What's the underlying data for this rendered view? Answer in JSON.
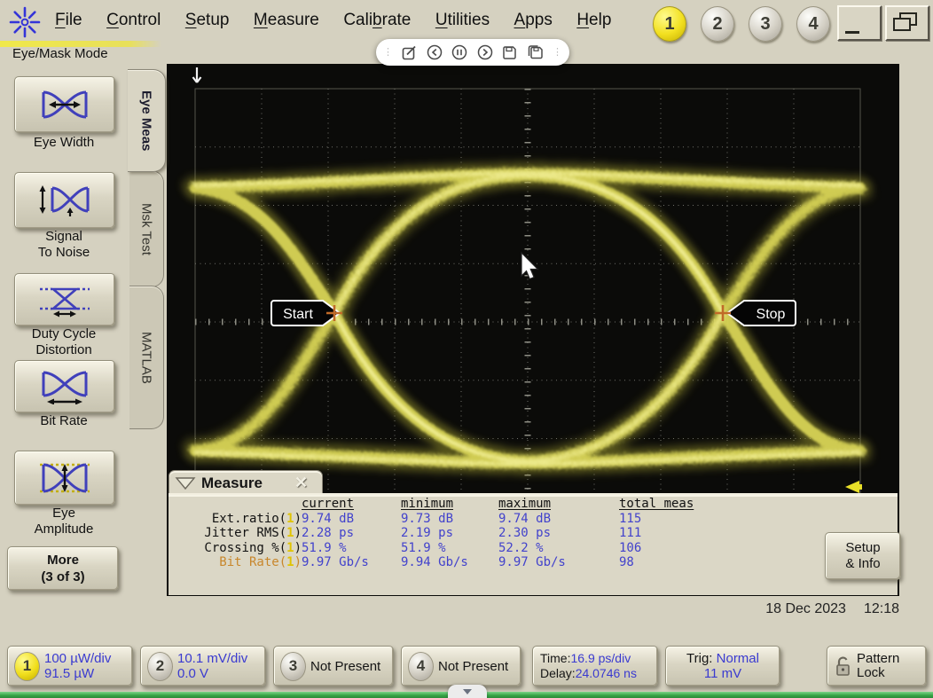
{
  "app": {
    "mode_label": "Eye/Mask Mode",
    "date": "18 Dec 2023",
    "time": "12:18"
  },
  "menu": {
    "items": [
      {
        "pre": "",
        "u": "F",
        "post": "ile"
      },
      {
        "pre": "",
        "u": "C",
        "post": "ontrol"
      },
      {
        "pre": "",
        "u": "S",
        "post": "etup"
      },
      {
        "pre": "",
        "u": "M",
        "post": "easure"
      },
      {
        "pre": "Cali",
        "u": "b",
        "post": "rate"
      },
      {
        "pre": "",
        "u": "U",
        "post": "tilities"
      },
      {
        "pre": "",
        "u": "A",
        "post": "pps"
      },
      {
        "pre": "",
        "u": "H",
        "post": "elp"
      }
    ],
    "screen_keys": [
      "1",
      "2",
      "3",
      "4"
    ]
  },
  "sidebar": {
    "tabs": [
      {
        "label": "Eye Meas",
        "selected": true
      },
      {
        "label": "Msk Test",
        "selected": false
      },
      {
        "label": "MATLAB",
        "selected": false
      }
    ],
    "buttons": [
      {
        "line1": "Eye Width",
        "line2": ""
      },
      {
        "line1": "Signal",
        "line2": "To Noise"
      },
      {
        "line1": "Duty Cycle",
        "line2": "Distortion"
      },
      {
        "line1": "Bit Rate",
        "line2": ""
      },
      {
        "line1": "Eye",
        "line2": "Amplitude"
      }
    ],
    "more": {
      "line1": "More",
      "line2": "(3 of 3)"
    }
  },
  "display": {
    "type": "eye-diagram",
    "start_label": "Start",
    "stop_label": "Stop"
  },
  "measure": {
    "title": "Measure",
    "close": "✕",
    "columns": [
      "current",
      "minimum",
      "maximum",
      "total meas"
    ],
    "rows": [
      {
        "name": "Ext.ratio(",
        "ch": "1",
        "cp": ")",
        "current": "9.74 dB",
        "minimum": "9.73 dB",
        "maximum": "9.74 dB",
        "total": "115",
        "highlight": false
      },
      {
        "name": "Jitter RMS(",
        "ch": "1",
        "cp": ")",
        "current": "2.28 ps",
        "minimum": "2.19 ps",
        "maximum": "2.30 ps",
        "total": "111",
        "highlight": false
      },
      {
        "name": "Crossing %(",
        "ch": "1",
        "cp": ")",
        "current": "51.9 %",
        "minimum": "51.9 %",
        "maximum": "52.2 %",
        "total": "106",
        "highlight": false
      },
      {
        "name": "Bit Rate(",
        "ch": "1",
        "cp": ")",
        "current": "9.97 Gb/s",
        "minimum": "9.94 Gb/s",
        "maximum": "9.97 Gb/s",
        "total": "98",
        "highlight": true
      }
    ],
    "setup_button": {
      "line1": "Setup",
      "line2": "& Info"
    }
  },
  "status": {
    "ch1": {
      "num": "1",
      "line1": "100 µW/div",
      "line2": "91.5 µW"
    },
    "ch2": {
      "num": "2",
      "line1": "10.1 mV/div",
      "line2": "0.0 V"
    },
    "ch3": {
      "num": "3",
      "line1": "Not Present"
    },
    "ch4": {
      "num": "4",
      "line1": "Not Present"
    },
    "time": {
      "l1": "Time:",
      "v1": "16.9 ps/div",
      "l2": "Delay:",
      "v2": "24.0746 ns"
    },
    "trig": {
      "l1": "Trig:",
      "v1": "Normal",
      "v2": "11 mV"
    },
    "pattern": {
      "line1": "Pattern",
      "line2": "Lock"
    }
  },
  "colors": {
    "chrome": "#d5d1c0",
    "screen_black": "#0b0b09",
    "trace_yellow": "#d8d455",
    "value_blue": "#4242cc",
    "channel_yellow": "#f0de1c",
    "highlight_orange": "#c8872c",
    "marker_orange": "#c06a28",
    "green_bar": "#35a344"
  }
}
